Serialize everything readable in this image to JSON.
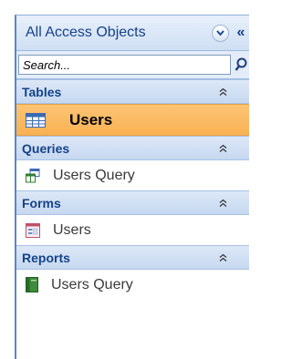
{
  "pane": {
    "title": "All Access Objects",
    "collapse_glyph": "«",
    "dropdown_icon": "chevron-down-icon"
  },
  "search": {
    "placeholder": "Search..."
  },
  "groups": [
    {
      "label": "Tables",
      "items": [
        {
          "label": "Users",
          "icon": "table-icon",
          "selected": true
        }
      ]
    },
    {
      "label": "Queries",
      "items": [
        {
          "label": "Users Query",
          "icon": "query-icon",
          "selected": false
        }
      ]
    },
    {
      "label": "Forms",
      "items": [
        {
          "label": "Users",
          "icon": "form-icon",
          "selected": false
        }
      ]
    },
    {
      "label": "Reports",
      "items": [
        {
          "label": "Users Query",
          "icon": "report-icon",
          "selected": false
        }
      ]
    }
  ],
  "colors": {
    "header_text": "#15428b",
    "selected_bg": "#fcc474",
    "pane_border": "#5b86c2"
  }
}
